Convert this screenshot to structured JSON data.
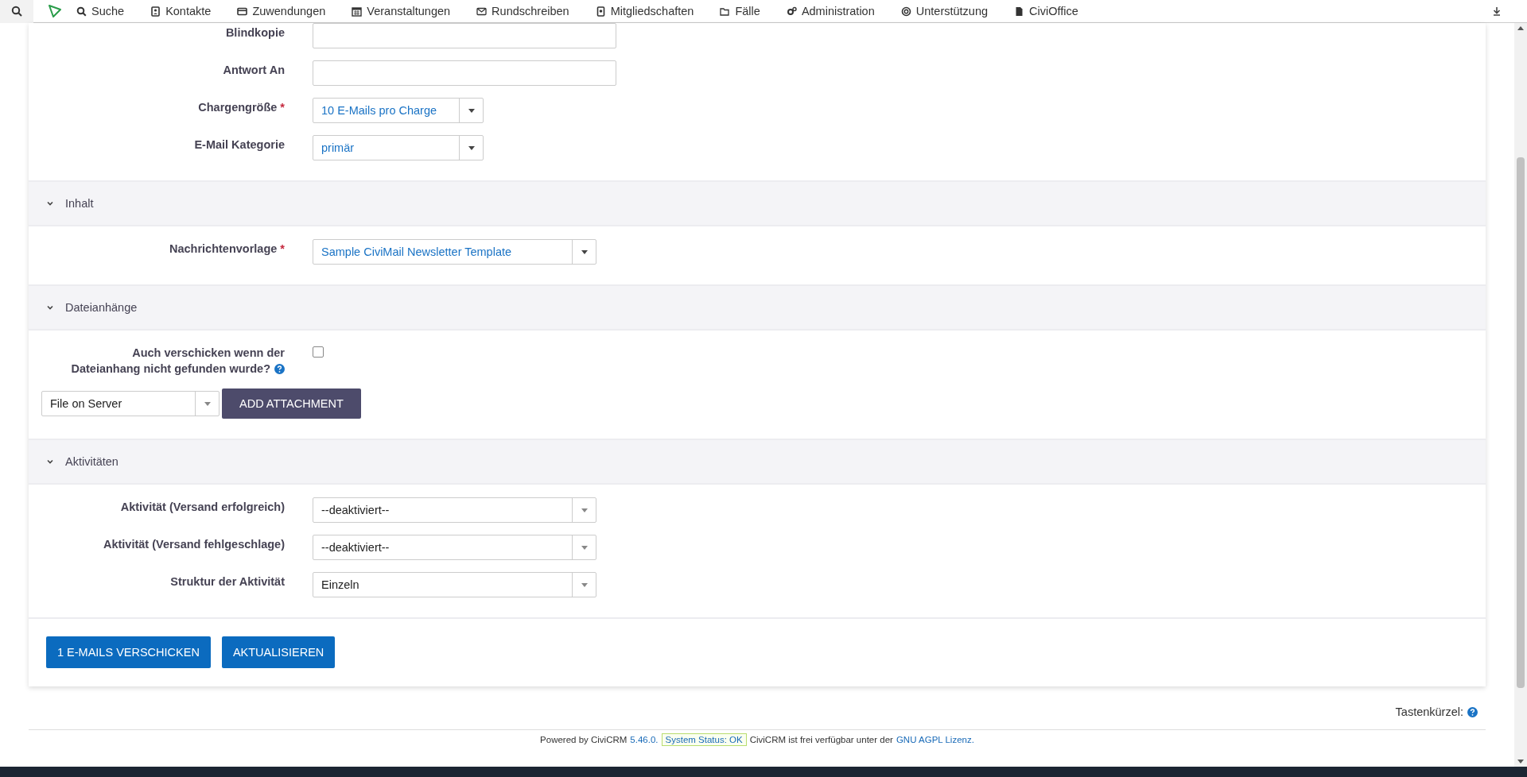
{
  "nav": {
    "items": [
      {
        "label": "Suche"
      },
      {
        "label": "Kontakte"
      },
      {
        "label": "Zuwendungen"
      },
      {
        "label": "Veranstaltungen"
      },
      {
        "label": "Rundschreiben"
      },
      {
        "label": "Mitgliedschaften"
      },
      {
        "label": "Fälle"
      },
      {
        "label": "Administration"
      },
      {
        "label": "Unterstützung"
      },
      {
        "label": "CiviOffice"
      }
    ]
  },
  "sections": [
    {
      "fields": [
        {
          "kind": "text",
          "label": "Blindkopie"
        },
        {
          "kind": "text",
          "label": "Antwort An"
        },
        {
          "kind": "choice",
          "label": "Chargengröße",
          "required_mark": "*",
          "value": "10 E-Mails pro Charge"
        },
        {
          "kind": "choice",
          "label": "E-Mail Kategorie",
          "value": "primär"
        }
      ]
    },
    {
      "title": "Inhalt",
      "expanded": true,
      "fields": [
        {
          "kind": "choice",
          "label": "Nachrichtenvorlage",
          "required_mark": "*",
          "value": "Sample CiviMail Newsletter Template"
        }
      ]
    },
    {
      "title": "Dateianhänge",
      "expanded": true,
      "fields": [
        {
          "kind": "checkbox",
          "label": "Auch verschicken wenn der Dateianhang nicht gefunden wurde?",
          "checked": false,
          "help": true
        },
        {
          "kind": "attachment",
          "value": "File on Server",
          "button": "ADD ATTACHMENT"
        }
      ]
    },
    {
      "title": "Aktivitäten",
      "expanded": true,
      "fields": [
        {
          "kind": "select",
          "label": "Aktivität (Versand erfolgreich)",
          "value": "--deaktiviert--"
        },
        {
          "kind": "select",
          "label": "Aktivität (Versand fehlgeschlage)",
          "value": "--deaktiviert--"
        },
        {
          "kind": "select",
          "label": "Struktur der Aktivität",
          "value": "Einzeln"
        }
      ]
    }
  ],
  "actions": [
    "1 E-MAILS VERSCHICKEN",
    "AKTUALISIEREN"
  ],
  "shortcuts": {
    "label": "Tastenkürzel:"
  },
  "footer": {
    "parts": [
      {
        "kind": "text",
        "text": "Powered by CiviCRM"
      },
      {
        "kind": "link",
        "text": "5.46.0."
      },
      {
        "kind": "status",
        "text": "System Status: OK"
      },
      {
        "kind": "text",
        "text": "CiviCRM ist frei verfügbar unter der"
      },
      {
        "kind": "link",
        "text": "GNU AGPL Lizenz."
      }
    ]
  }
}
